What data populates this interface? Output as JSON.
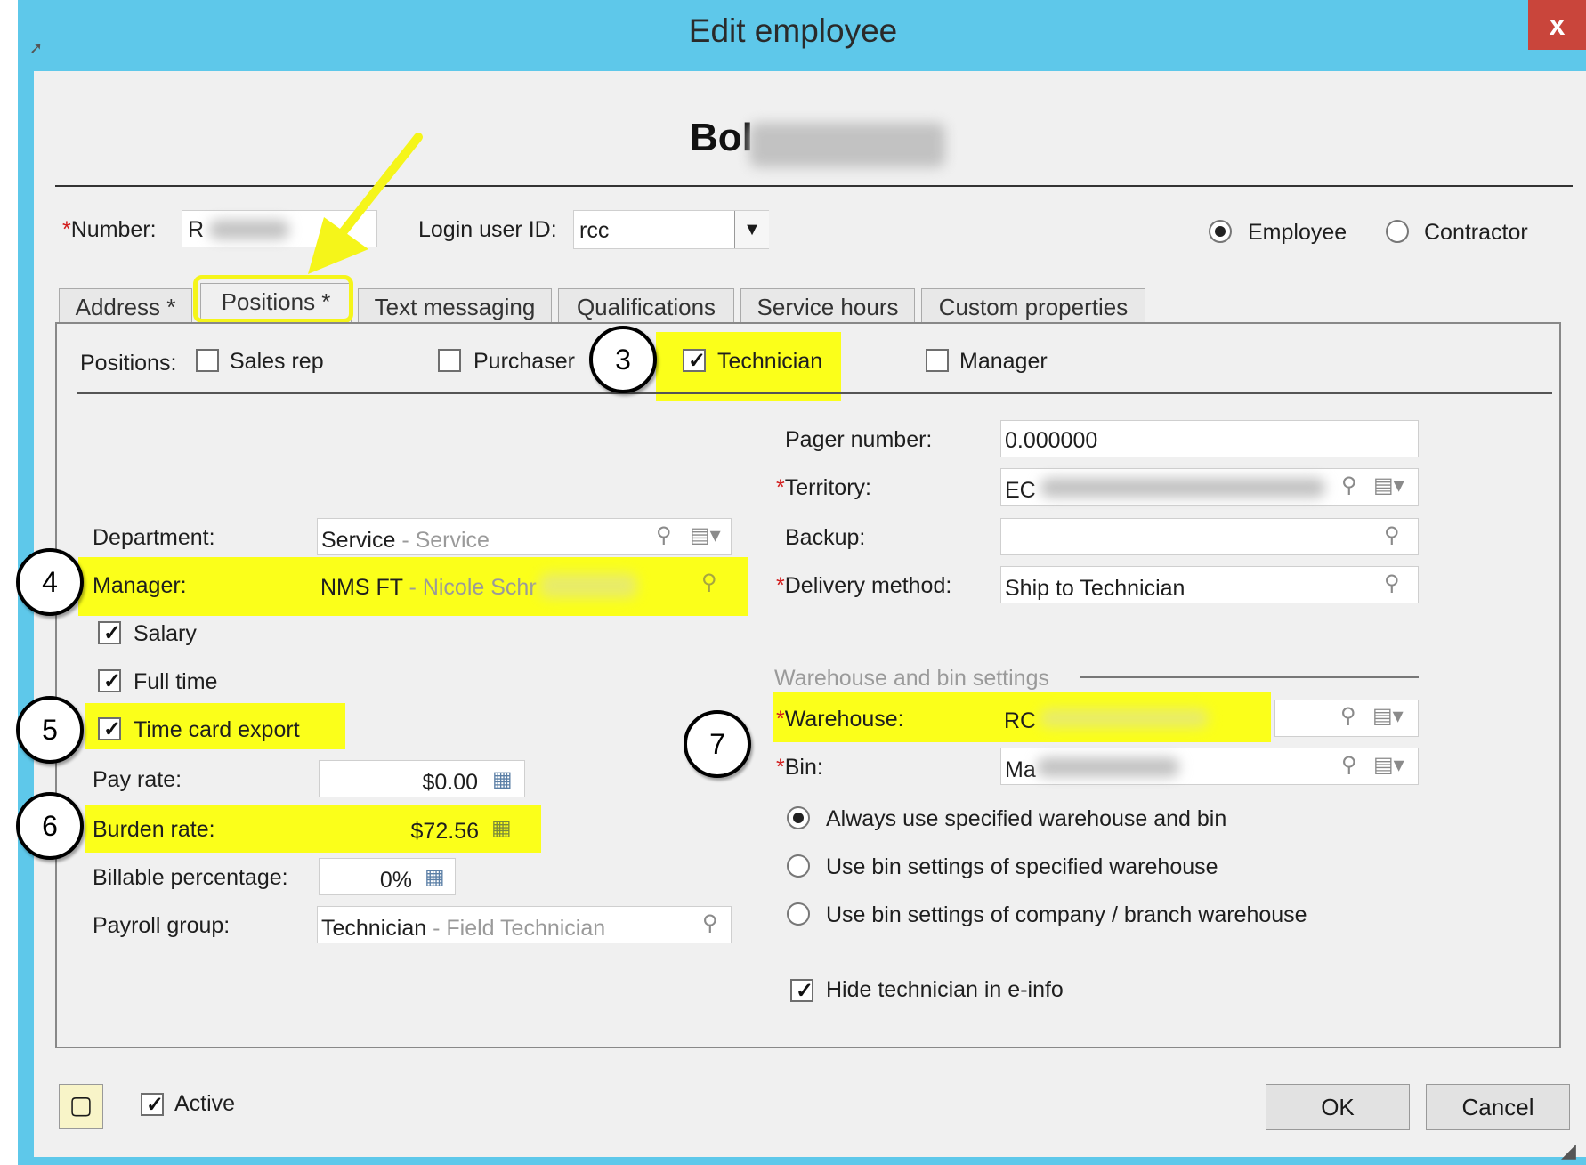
{
  "window": {
    "title": "Edit employee",
    "close_label": "x"
  },
  "employee": {
    "name_visible": "Bol"
  },
  "header": {
    "number_label": "Number:",
    "number_value": "R",
    "login_label": "Login user ID:",
    "login_value": "rcc",
    "type_options": [
      {
        "label": "Employee",
        "selected": true
      },
      {
        "label": "Contractor",
        "selected": false
      }
    ]
  },
  "tabs": [
    {
      "label": "Address *",
      "active": false
    },
    {
      "label": "Positions *",
      "active": true
    },
    {
      "label": "Text messaging",
      "active": false
    },
    {
      "label": "Qualifications",
      "active": false
    },
    {
      "label": "Service hours",
      "active": false
    },
    {
      "label": "Custom properties",
      "active": false
    }
  ],
  "positions": {
    "label": "Positions:",
    "items": [
      {
        "label": "Sales rep",
        "checked": false
      },
      {
        "label": "Purchaser",
        "checked": false
      },
      {
        "label": "Technician",
        "checked": true
      },
      {
        "label": "Manager",
        "checked": false
      }
    ]
  },
  "left": {
    "department": {
      "label": "Department:",
      "code": "Service",
      "desc": "- Service"
    },
    "manager": {
      "label": "Manager:",
      "code": "NMS FT",
      "desc": "- Nicole Schr"
    },
    "salary": {
      "label": "Salary",
      "checked": true
    },
    "full_time": {
      "label": "Full time",
      "checked": true
    },
    "time_card_export": {
      "label": "Time card export",
      "checked": true
    },
    "pay_rate": {
      "label": "Pay rate:",
      "value": "$0.00"
    },
    "burden_rate": {
      "label": "Burden rate:",
      "value": "$72.56"
    },
    "billable_percentage": {
      "label": "Billable percentage:",
      "value": "0%"
    },
    "payroll_group": {
      "label": "Payroll group:",
      "code": "Technician",
      "desc": "- Field Technician"
    }
  },
  "right": {
    "pager_number": {
      "label": "Pager number:",
      "value": "0.000000"
    },
    "territory": {
      "label": "Territory:",
      "value": "EC"
    },
    "backup": {
      "label": "Backup:",
      "value": ""
    },
    "delivery_method": {
      "label": "Delivery method:",
      "value": "Ship to Technician"
    },
    "warehouse_section": "Warehouse and bin settings",
    "warehouse": {
      "label": "Warehouse:",
      "value": "RC"
    },
    "bin": {
      "label": "Bin:",
      "value": "Ma"
    },
    "bin_options": [
      {
        "label": "Always use specified warehouse and bin",
        "selected": true
      },
      {
        "label": "Use bin settings of specified warehouse",
        "selected": false
      },
      {
        "label": "Use bin settings of company / branch warehouse",
        "selected": false
      }
    ],
    "hide_technician": {
      "label": "Hide technician in e-info",
      "checked": true
    }
  },
  "footer": {
    "active_label": "Active",
    "active_checked": true,
    "ok_label": "OK",
    "cancel_label": "Cancel"
  },
  "annotations": {
    "callouts": [
      "3",
      "4",
      "5",
      "6",
      "7"
    ],
    "highlight_color": "#fbff1a",
    "arrow_color": "#f5f51a"
  }
}
